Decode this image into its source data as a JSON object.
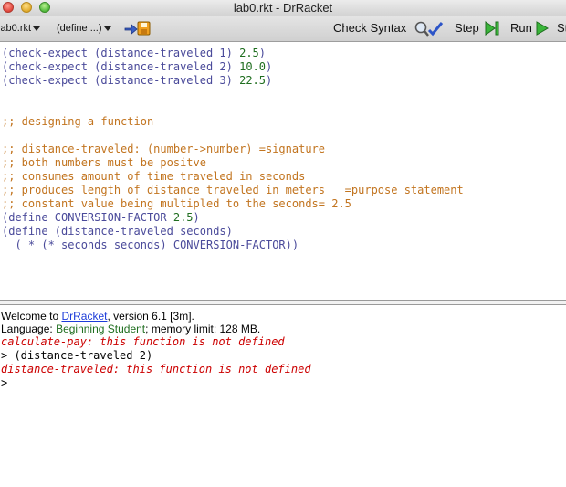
{
  "window": {
    "title": "lab0.rkt - DrRacket"
  },
  "toolbar": {
    "file_menu": "lab0.rkt",
    "define_menu": "(define ...)",
    "check_syntax": "Check Syntax",
    "step": "Step",
    "run": "Run",
    "stop_partial": "St"
  },
  "editor": {
    "lines": [
      {
        "text": "(check-expect (distance-traveled 1) ",
        "num": "2.5",
        "close": ")"
      },
      {
        "text": "(check-expect (distance-traveled 2) ",
        "num": "10.0",
        "close": ")"
      },
      {
        "text": "(check-expect (distance-traveled 3) ",
        "num": "22.5",
        "close": ")"
      },
      {
        "comment": ";; designing a function"
      },
      {
        "comment": ";; distance-traveled: (number->number) =signature"
      },
      {
        "comment": ";; both numbers must be positve"
      },
      {
        "comment": ";; consumes amount of time traveled in seconds"
      },
      {
        "comment": ";; produces length of distance traveled in meters   =purpose statement"
      },
      {
        "comment": ";; constant value being multipled to the seconds= 2.5"
      },
      {
        "text": "(define CONVERSION-FACTOR ",
        "num": "2.5",
        "close": ")"
      },
      {
        "text": "(define (distance-traveled seconds)"
      },
      {
        "text": "  ( * (* seconds seconds) CONVERSION-FACTOR))"
      }
    ]
  },
  "repl": {
    "welcome_prefix": "Welcome to ",
    "welcome_link": "DrRacket",
    "welcome_suffix": ", version 6.1 [3m].",
    "language_prefix": "Language: ",
    "language_name": "Beginning Student",
    "language_suffix": "; memory limit: 128 MB.",
    "error1": "calculate-pay: this function is not defined",
    "prompt1": "> (distance-traveled 2)",
    "error2": "distance-traveled: this function is not defined",
    "prompt2": ">"
  },
  "colors": {
    "paren": "#4a4a9a",
    "number": "#1f6e1f",
    "comment": "#c2741f",
    "error": "#cc0000",
    "link": "#1c3cd9"
  }
}
